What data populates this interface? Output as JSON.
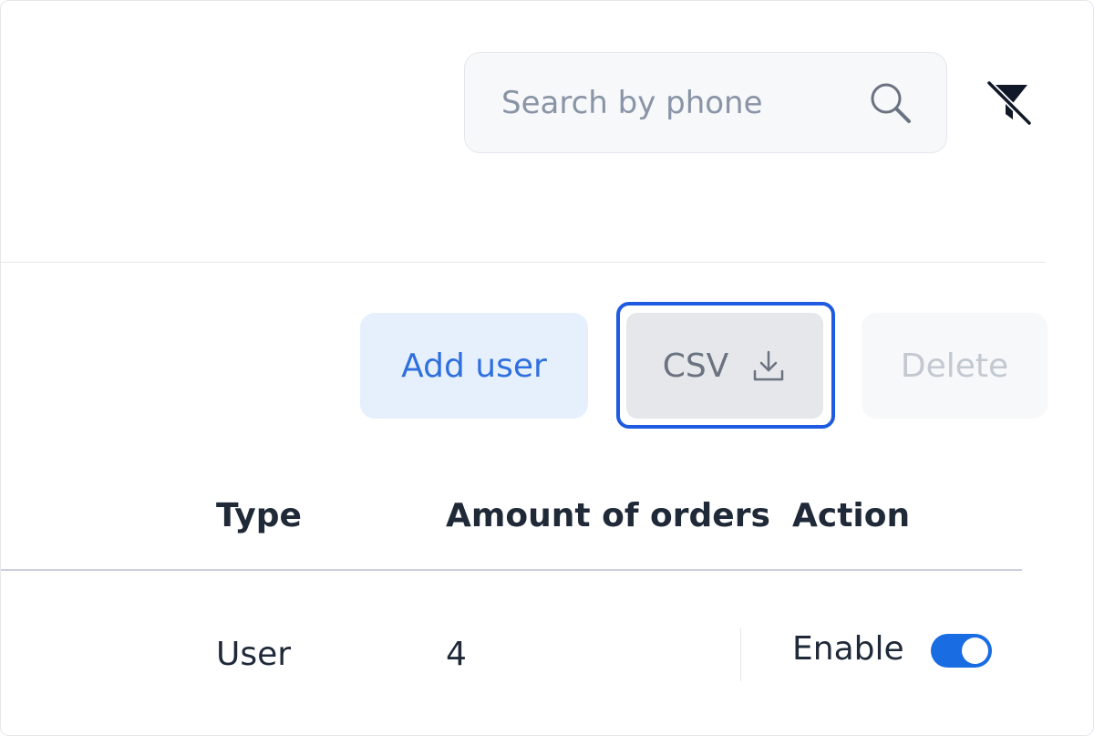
{
  "search": {
    "placeholder": "Search by phone",
    "value": ""
  },
  "toolbar": {
    "add_user_label": "Add user",
    "csv_label": "CSV",
    "delete_label": "Delete"
  },
  "table": {
    "columns": [
      "Type",
      "Amount of orders",
      "Action"
    ],
    "rows": [
      {
        "type": "User",
        "amount_of_orders": "4",
        "action_label": "Enable",
        "enabled": true
      }
    ]
  },
  "colors": {
    "accent": "#1a6ce3",
    "focus_ring": "#1e5be0",
    "add_user_bg": "#e6f0fd",
    "add_user_text": "#2f6fde"
  },
  "icons": {
    "search": "search-icon",
    "filter_off": "filter-off-icon",
    "download": "download-icon"
  }
}
